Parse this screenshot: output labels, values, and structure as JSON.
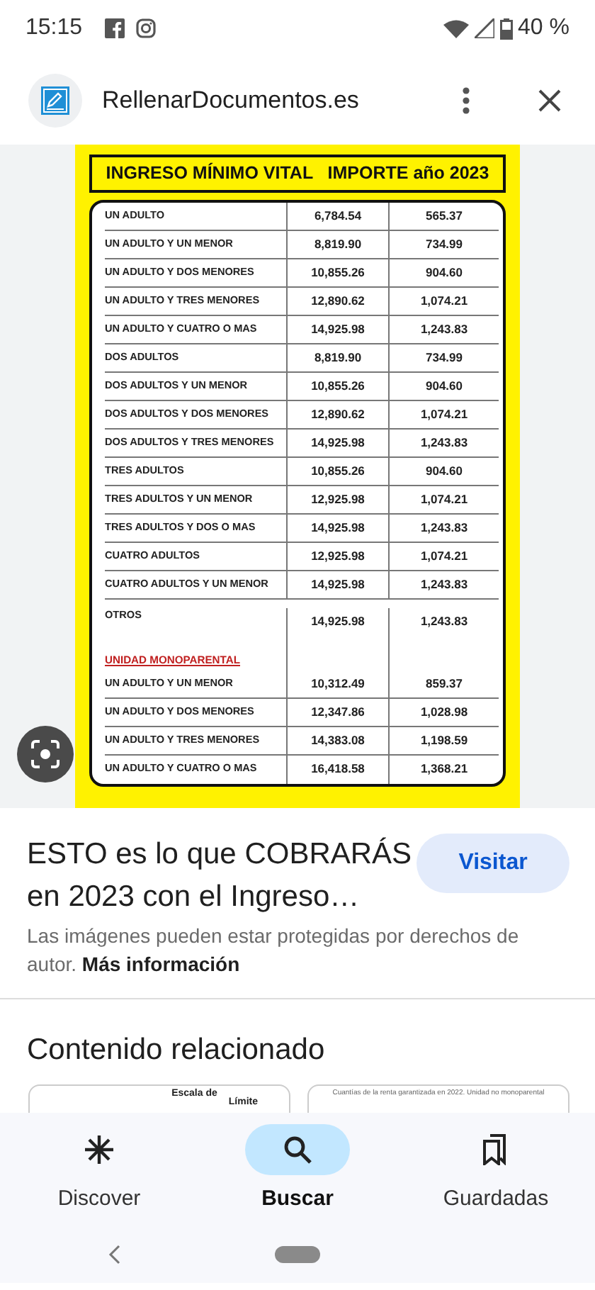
{
  "status_bar": {
    "time": "15:15",
    "battery": "40 %"
  },
  "header": {
    "site": "RellenarDocumentos.es"
  },
  "document": {
    "title": "INGRESO MÍNIMO VITAL   IMPORTE año 2023",
    "rows": [
      {
        "label": "UN ADULTO",
        "annual": "6,784.54",
        "monthly": "565.37"
      },
      {
        "label": "UN ADULTO Y UN MENOR",
        "annual": "8,819.90",
        "monthly": "734.99"
      },
      {
        "label": "UN ADULTO Y DOS MENORES",
        "annual": "10,855.26",
        "monthly": "904.60"
      },
      {
        "label": "UN ADULTO Y TRES MENORES",
        "annual": "12,890.62",
        "monthly": "1,074.21"
      },
      {
        "label": "UN ADULTO Y CUATRO O MAS",
        "annual": "14,925.98",
        "monthly": "1,243.83"
      },
      {
        "label": "DOS ADULTOS",
        "annual": "8,819.90",
        "monthly": "734.99"
      },
      {
        "label": "DOS ADULTOS Y UN MENOR",
        "annual": "10,855.26",
        "monthly": "904.60"
      },
      {
        "label": "DOS ADULTOS Y DOS MENORES",
        "annual": "12,890.62",
        "monthly": "1,074.21"
      },
      {
        "label": "DOS ADULTOS Y TRES MENORES",
        "annual": "14,925.98",
        "monthly": "1,243.83"
      },
      {
        "label": "TRES ADULTOS",
        "annual": "10,855.26",
        "monthly": "904.60"
      },
      {
        "label": "TRES ADULTOS Y UN MENOR",
        "annual": "12,925.98",
        "monthly": "1,074.21"
      },
      {
        "label": "TRES ADULTOS Y DOS O MAS",
        "annual": "14,925.98",
        "monthly": "1,243.83"
      },
      {
        "label": "CUATRO ADULTOS",
        "annual": "12,925.98",
        "monthly": "1,074.21"
      },
      {
        "label": "CUATRO ADULTOS Y UN MENOR",
        "annual": "14,925.98",
        "monthly": "1,243.83"
      },
      {
        "label": "OTROS",
        "annual": "14,925.98",
        "monthly": "1,243.83"
      }
    ],
    "section": "UNIDAD MONOPARENTAL",
    "section_rows": [
      {
        "label": "UN ADULTO Y UN MENOR",
        "annual": "10,312.49",
        "monthly": "859.37"
      },
      {
        "label": "UN ADULTO Y DOS MENORES",
        "annual": "12,347.86",
        "monthly": "1,028.98"
      },
      {
        "label": "UN ADULTO Y TRES MENORES",
        "annual": "14,383.08",
        "monthly": "1,198.59"
      },
      {
        "label": "UN ADULTO Y CUATRO O MAS",
        "annual": "16,418.58",
        "monthly": "1,368.21"
      }
    ]
  },
  "result": {
    "title": "ESTO es lo que COBRARÁS en 2023 con el Ingreso…",
    "button": "Visitar",
    "notice": "Las imágenes pueden estar protegidas por derechos de autor.",
    "link": "Más información"
  },
  "related": {
    "heading": "Contenido relacionado",
    "thumbnails": [
      {
        "texts": [
          "Escala de",
          "Límite"
        ]
      },
      {
        "texts": [
          "Cuantías de la renta garantizada en 2022. Unidad no monoparental"
        ]
      }
    ]
  },
  "nav": [
    {
      "label": "Discover",
      "selected": false
    },
    {
      "label": "Buscar",
      "selected": true
    },
    {
      "label": "Guardadas",
      "selected": false
    }
  ]
}
